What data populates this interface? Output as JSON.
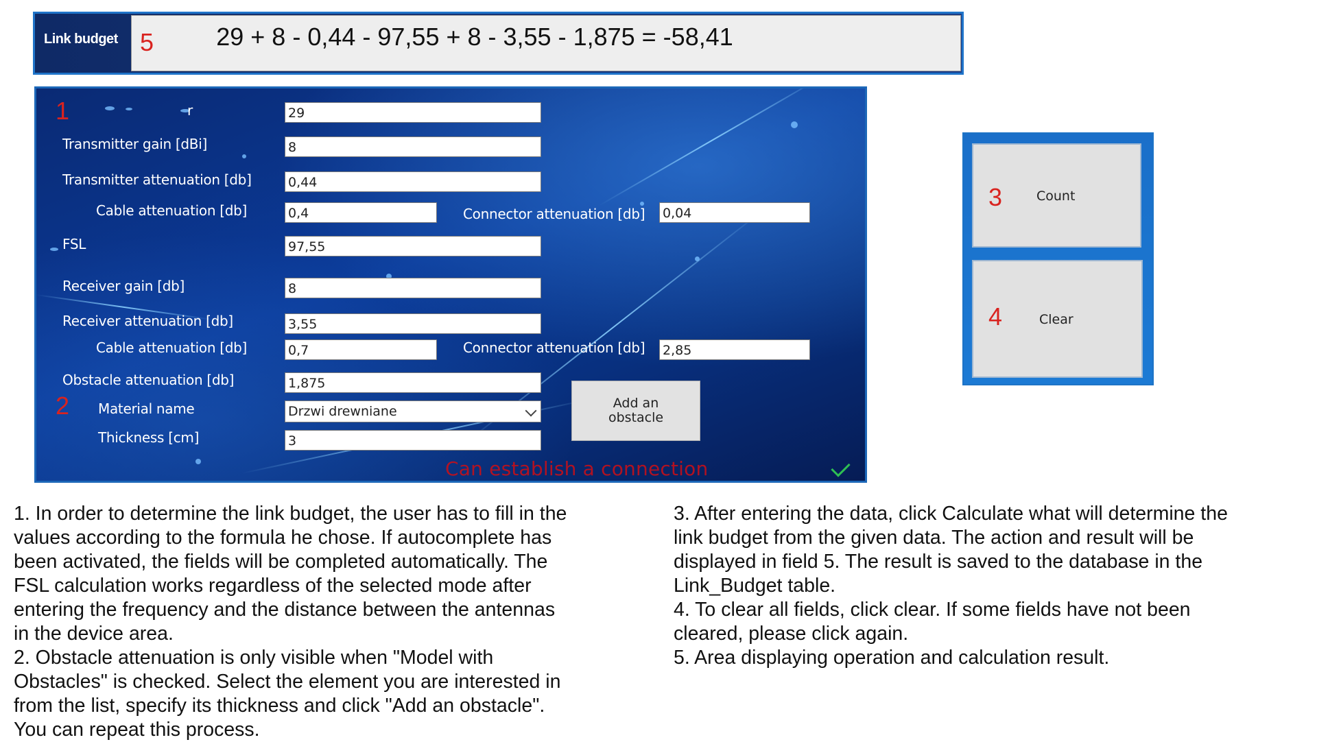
{
  "topbar": {
    "label": "Link budget",
    "marker": "5",
    "result": "29 + 8 - 0,44 - 97,55 + 8 - 3,55 - 1,875 = -58,41"
  },
  "panel": {
    "markers": {
      "one": "1",
      "two": "2"
    },
    "frequency_label": "r",
    "frequency_value": "29",
    "tx_gain_label": "Transmitter gain [dBi]",
    "tx_gain_value": "8",
    "tx_atten_label": "Transmitter attenuation [db]",
    "tx_atten_value": "0,44",
    "tx_cable_label": "Cable attenuation [db]",
    "tx_cable_value": "0,4",
    "tx_connector_label": "Connector attenuation [db]",
    "tx_connector_value": "0,04",
    "fsl_label": "FSL",
    "fsl_value": "97,55",
    "rx_gain_label": "Receiver gain [db]",
    "rx_gain_value": "8",
    "rx_atten_label": "Receiver attenuation [db]",
    "rx_atten_value": "3,55",
    "rx_cable_label": "Cable attenuation [db]",
    "rx_cable_value": "0,7",
    "rx_connector_label": "Connector attenuation [db]",
    "rx_connector_value": "2,85",
    "obstacle_label": "Obstacle attenuation [db]",
    "obstacle_value": "1,875",
    "material_label": "Material name",
    "material_value": "Drzwi drewniane",
    "thickness_label": "Thickness [cm]",
    "thickness_value": "3",
    "add_button_line1": "Add an",
    "add_button_line2": "obstacle",
    "status_text": "Can establish a connection",
    "status_color": "#c4101a"
  },
  "side_buttons": {
    "count_marker": "3",
    "count_label": "Count",
    "clear_marker": "4",
    "clear_label": "Clear"
  },
  "instructions": {
    "left": [
      "1. In order to determine the link budget, the user has to fill in the",
      "values according to the formula he chose. If autocomplete has",
      "been activated, the fields will be completed automatically. The",
      "FSL calculation works regardless of the selected mode after",
      "entering the frequency and the distance between the antennas",
      "in the device area.",
      "2. Obstacle attenuation is only visible when \"Model with",
      "Obstacles\" is checked. Select the element you are interested in",
      "from the list, specify its thickness and click \"Add an obstacle\".",
      "You can repeat this process."
    ],
    "right": [
      "3. After entering the data, click Calculate what will determine the",
      "link budget from the given data. The action and result will be",
      "displayed in field 5. The result is saved to the database in the",
      "Link_Budget table.",
      "4. To clear all fields, click clear. If some fields have not been",
      "cleared, please click again.",
      "5. Area displaying operation and calculation result."
    ]
  },
  "colors": {
    "marker_red": "#d9231f",
    "panel_blue": "#0b3b9a",
    "check_green": "#2fbf53"
  }
}
